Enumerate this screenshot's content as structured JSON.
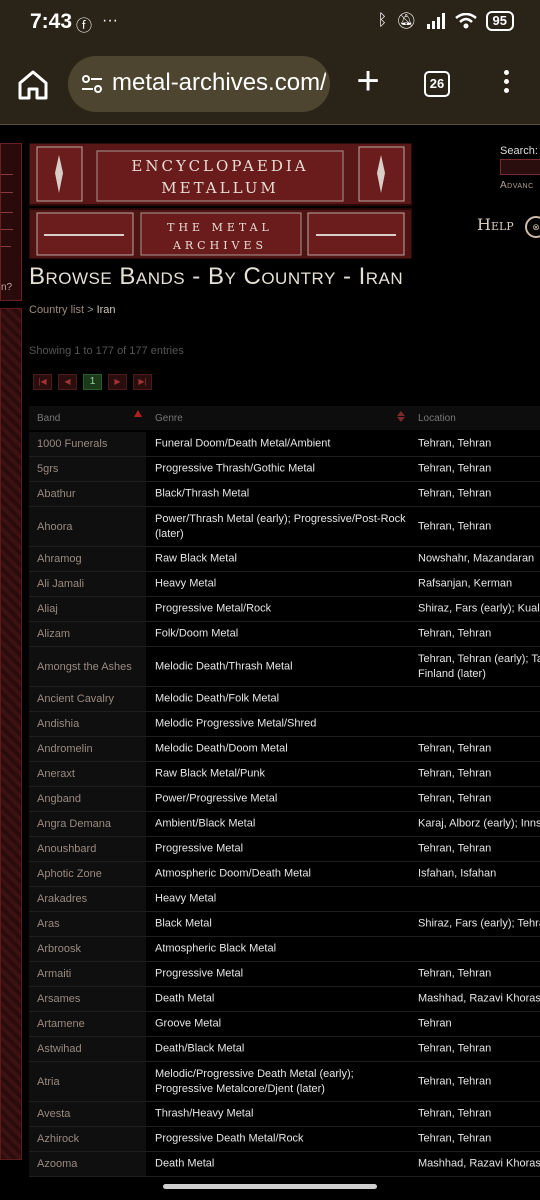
{
  "status_bar": {
    "time": "7:43",
    "battery": "95"
  },
  "browser": {
    "url": "metal-archives.com/",
    "tab_count": "26"
  },
  "site": {
    "logo_line1": "ENCYCLOPAEDIA",
    "logo_line2": "METALLUM",
    "logo_line3": "THE METAL",
    "logo_line4": "ARCHIVES",
    "search_label": "Search:",
    "advanced_label": "Advanc",
    "help_label": "Help",
    "left_panel_text": "n?"
  },
  "page": {
    "title": "Browse Bands - By Country - Iran",
    "breadcrumb_link": "Country list",
    "breadcrumb_sep": " > ",
    "breadcrumb_current": "Iran",
    "showing": "Showing 1 to 177 of 177 entries",
    "current_page": "1"
  },
  "table": {
    "headers": {
      "band": "Band",
      "genre": "Genre",
      "location": "Location"
    },
    "rows": [
      {
        "band": "1000 Funerals",
        "genre": "Funeral Doom/Death Metal/Ambient",
        "location": "Tehran, Tehran"
      },
      {
        "band": "5grs",
        "genre": "Progressive Thrash/Gothic Metal",
        "location": "Tehran, Tehran"
      },
      {
        "band": "Abathur",
        "genre": "Black/Thrash Metal",
        "location": "Tehran, Tehran"
      },
      {
        "band": "Ahoora",
        "genre": "Power/Thrash Metal (early); Progressive/Post-Rock (later)",
        "location": "Tehran, Tehran"
      },
      {
        "band": "Ahramog",
        "genre": "Raw Black Metal",
        "location": "Nowshahr, Mazandaran"
      },
      {
        "band": "Ali Jamali",
        "genre": "Heavy Metal",
        "location": "Rafsanjan, Kerman"
      },
      {
        "band": "Aliaj",
        "genre": "Progressive Metal/Rock",
        "location": "Shiraz, Fars (early); Kuala L"
      },
      {
        "band": "Alizam",
        "genre": "Folk/Doom Metal",
        "location": "Tehran, Tehran"
      },
      {
        "band": "Amongst the Ashes",
        "genre": "Melodic Death/Thrash Metal",
        "location": "Tehran, Tehran (early); Tam\nFinland (later)"
      },
      {
        "band": "Ancient Cavalry",
        "genre": "Melodic Death/Folk Metal",
        "location": ""
      },
      {
        "band": "Andishia",
        "genre": "Melodic Progressive Metal/Shred",
        "location": ""
      },
      {
        "band": "Andromelin",
        "genre": "Melodic Death/Doom Metal",
        "location": "Tehran, Tehran"
      },
      {
        "band": "Aneraxt",
        "genre": "Raw Black Metal/Punk",
        "location": "Tehran, Tehran"
      },
      {
        "band": "Angband",
        "genre": "Power/Progressive Metal",
        "location": "Tehran, Tehran"
      },
      {
        "band": "Angra Demana",
        "genre": "Ambient/Black Metal",
        "location": "Karaj, Alborz (early); Innsbr"
      },
      {
        "band": "Anoushbard",
        "genre": "Progressive Metal",
        "location": "Tehran, Tehran"
      },
      {
        "band": "Aphotic Zone",
        "genre": "Atmospheric Doom/Death Metal",
        "location": "Isfahan, Isfahan"
      },
      {
        "band": "Arakadres",
        "genre": "Heavy Metal",
        "location": ""
      },
      {
        "band": "Aras",
        "genre": "Black Metal",
        "location": "Shiraz, Fars (early); Tehran"
      },
      {
        "band": "Arbroosk",
        "genre": "Atmospheric Black Metal",
        "location": ""
      },
      {
        "band": "Armaiti",
        "genre": "Progressive Metal",
        "location": "Tehran, Tehran"
      },
      {
        "band": "Arsames",
        "genre": "Death Metal",
        "location": "Mashhad, Razavi Khorasan"
      },
      {
        "band": "Artamene",
        "genre": "Groove Metal",
        "location": "Tehran"
      },
      {
        "band": "Astwihad",
        "genre": "Death/Black Metal",
        "location": "Tehran, Tehran"
      },
      {
        "band": "Atria",
        "genre": "Melodic/Progressive Death Metal (early); Progressive Metalcore/Djent (later)",
        "location": "Tehran, Tehran"
      },
      {
        "band": "Avesta",
        "genre": "Thrash/Heavy Metal",
        "location": "Tehran, Tehran"
      },
      {
        "band": "Azhirock",
        "genre": "Progressive Death Metal/Rock",
        "location": "Tehran, Tehran"
      },
      {
        "band": "Azooma",
        "genre": "Death Metal",
        "location": "Mashhad, Razavi Khorasan"
      }
    ]
  }
}
